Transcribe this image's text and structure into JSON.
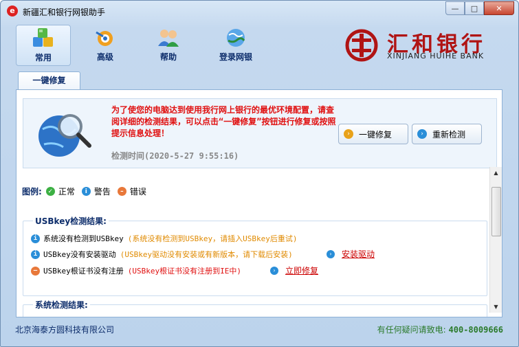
{
  "window": {
    "title": "新疆汇和银行网银助手",
    "controls": {
      "minimize": "—",
      "maximize": "□",
      "close": "✕"
    }
  },
  "toolbar": {
    "items": [
      {
        "label": "常用",
        "icon": "cubes-icon",
        "active": true
      },
      {
        "label": "高级",
        "icon": "advanced-gear-icon",
        "active": false
      },
      {
        "label": "帮助",
        "icon": "users-help-icon",
        "active": false
      },
      {
        "label": "登录网银",
        "icon": "login-globe-icon",
        "active": false
      }
    ]
  },
  "bank_logo": {
    "name_cn": "汇和银行",
    "name_en": "XINJIANG HUIHE BANK",
    "brand_color": "#b01414"
  },
  "tabs": [
    {
      "label": "一键修复",
      "active": true
    }
  ],
  "summary": {
    "message": "为了使您的电脑达到使用我行网上银行的最优环境配置，请查阅详细的检测结果，可以点击“一键修复”按钮进行修复或按照提示信息处理！",
    "check_time_label": "检测时间",
    "check_time_value": "(2020-5-27 9:55:16)",
    "buttons": {
      "repair": "一键修复",
      "recheck": "重新检测"
    }
  },
  "legend": {
    "title": "图例:",
    "items": [
      {
        "label": "正常",
        "status": "ok",
        "icon": "check-icon"
      },
      {
        "label": "警告",
        "status": "warn",
        "icon": "info-icon"
      },
      {
        "label": "错误",
        "status": "err",
        "icon": "minus-icon"
      }
    ]
  },
  "usbkey_section": {
    "title": "USBkey检测结果:",
    "rows": [
      {
        "status": "warn",
        "name": "系统没有检测到USBkey",
        "desc": "(系统没有检测到USBkey，请插入USBkey后重试)",
        "action": ""
      },
      {
        "status": "warn",
        "name": "USBkey没有安装驱动",
        "desc": "(USBkey驱动没有安装或有新版本，请下载后安装)",
        "action": "安装驱动"
      },
      {
        "status": "err",
        "name": "USBkey根证书没有注册",
        "desc": "(USBkey根证书没有注册到IE中)",
        "action": "立即修复"
      }
    ]
  },
  "system_section": {
    "title": "系统检测结果:"
  },
  "status_bar": {
    "company": "北京海泰方圆科技有限公司",
    "hotline_label": "有任何疑问请致电:",
    "hotline_number": "400-8009666"
  },
  "colors": {
    "accent": "#0d2d6b",
    "warning_text": "#e08a00",
    "error_text": "#e01010",
    "link": "#cc0000",
    "ok": "#3cb043",
    "warn": "#2a8ed8",
    "err": "#e8783a"
  }
}
